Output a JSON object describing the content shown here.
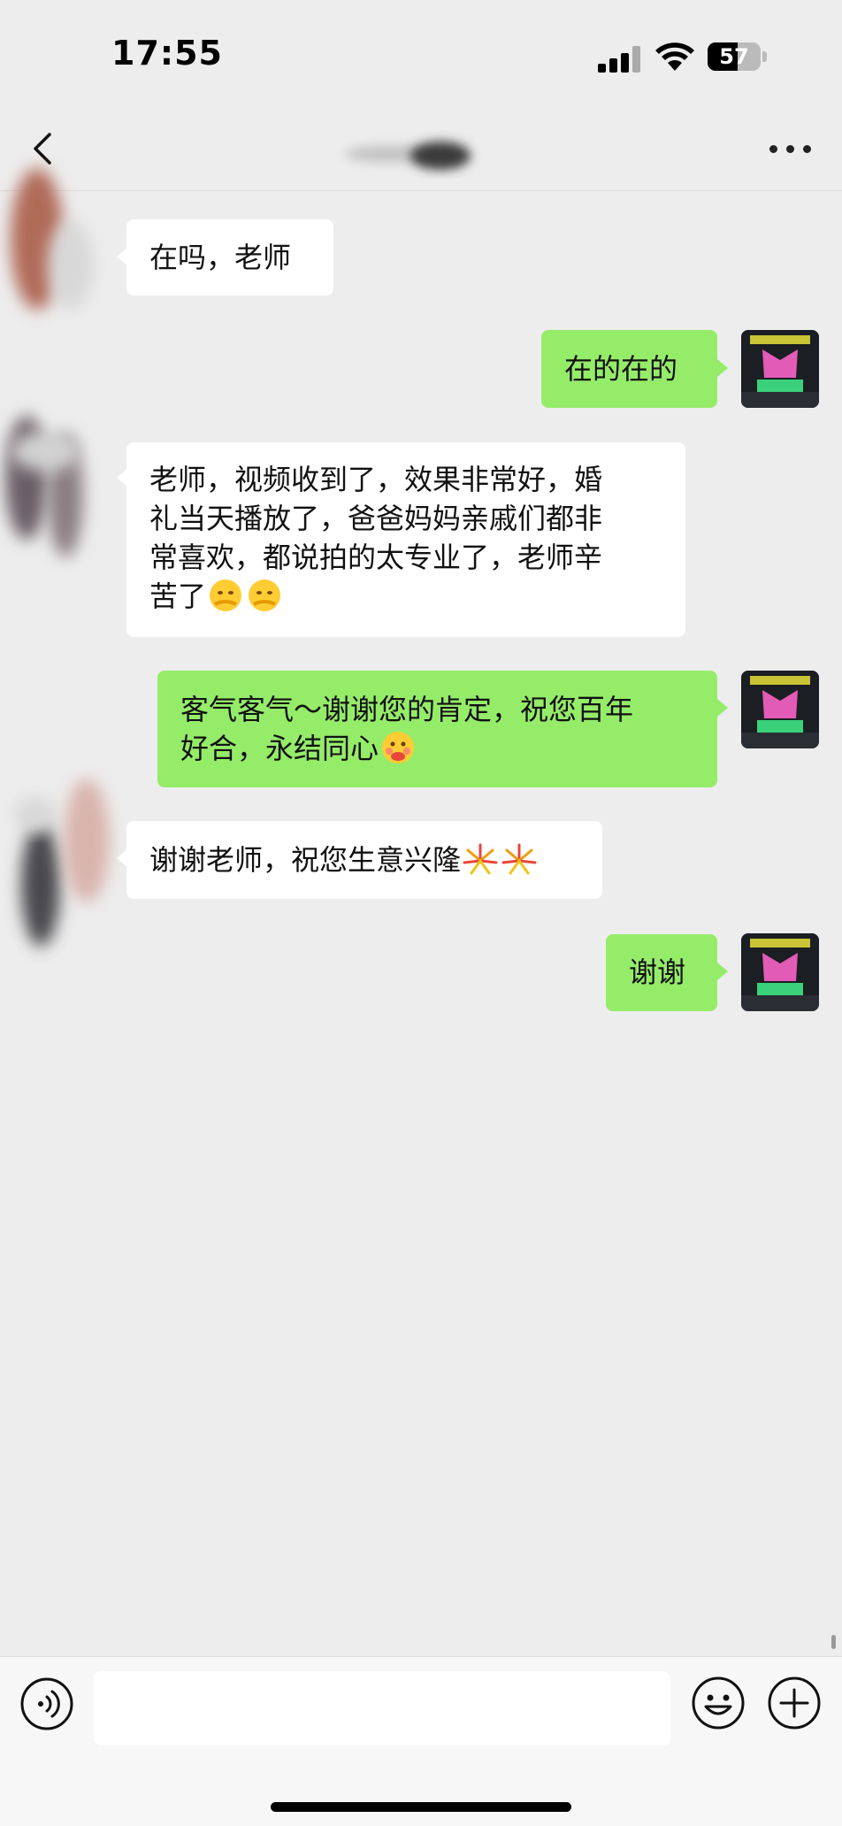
{
  "status_bar": {
    "time": "17:55",
    "battery": "57"
  },
  "chat": {
    "messages": [
      {
        "side": "left",
        "text": "在吗，老师"
      },
      {
        "side": "right",
        "text": "在的在的"
      },
      {
        "side": "left",
        "line1": "老师，视频收到了，效果非常好，婚",
        "line2": "礼当天播放了，爸爸妈妈亲戚们都非",
        "line3": "常喜欢，都说拍的太专业了，老师辛",
        "line4": "苦了",
        "emoji": "shy-face-emoji"
      },
      {
        "side": "right",
        "line1": "客气客气～谢谢您的肯定，祝您百年",
        "line2": "好合，永结同心",
        "emoji": "blushing-face-emoji"
      },
      {
        "side": "left",
        "text": "谢谢老师，祝您生意兴隆",
        "emoji": "fireworks-emoji"
      },
      {
        "side": "right",
        "text": "谢谢"
      }
    ]
  },
  "input_bar": {
    "placeholder": ""
  },
  "colors": {
    "background": "#ededed",
    "my_bubble": "#95ec69",
    "their_bubble": "#ffffff"
  }
}
